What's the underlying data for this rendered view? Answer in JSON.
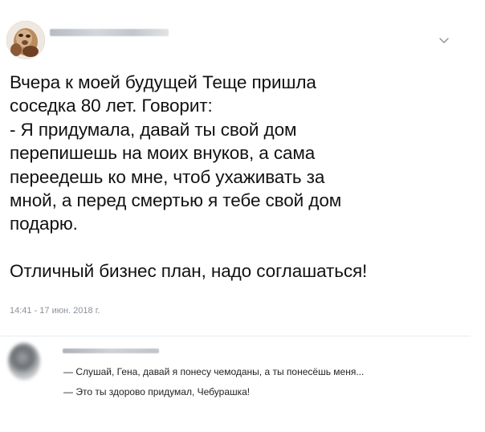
{
  "post": {
    "text": "Вчера к моей будущей Теще пришла\nсоседка 80 лет. Говорит:\n- Я придумала, давай ты свой дом\nперепишешь на моих внуков, а сама\nпереедешь ко мне, чтоб ухаживать за\nмной, а перед смертью я тебе свой дом\nподарю.\n\nОтличный бизнес план, надо соглашаться!",
    "timestamp": "14:41 - 17 июн. 2018 г."
  },
  "reply": {
    "lines": [
      "— Слушай, Гена, давай я понесу чемоданы, а ты понесёшь меня...",
      "— Это ты здорово придумал, Чебурашка!"
    ]
  },
  "icons": {
    "menu": "chevron-down-icon"
  },
  "colors": {
    "text": "#14171a",
    "muted": "#8a9199",
    "divider": "#e6ecf0"
  }
}
